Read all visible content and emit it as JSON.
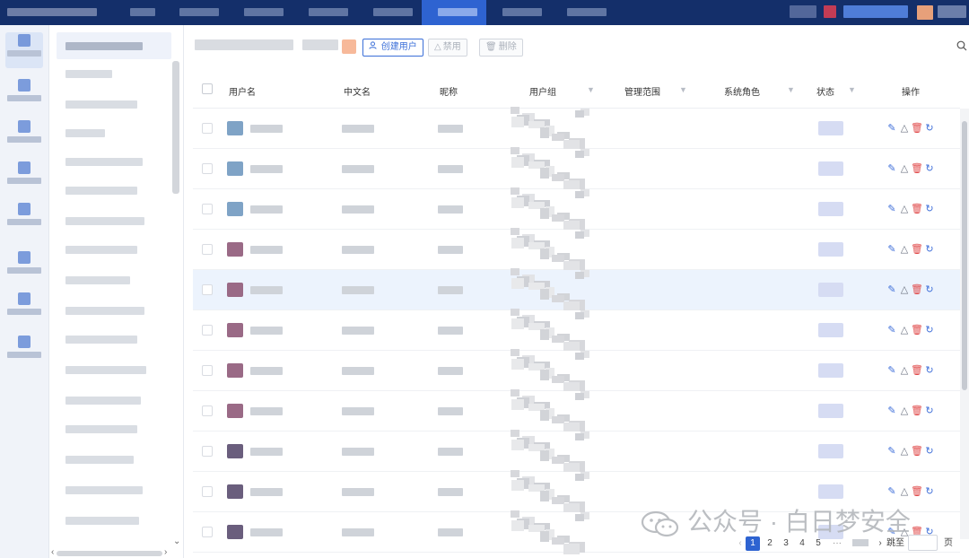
{
  "toolbar": {
    "create_user_label": "创建用户",
    "disable_label": "禁用",
    "delete_label": "删除"
  },
  "table": {
    "columns": {
      "username": "用户名",
      "chinese_name": "中文名",
      "nickname": "昵称",
      "user_group": "用户组",
      "scope": "管理范围",
      "system_role": "系统角色",
      "status": "状态",
      "actions": "操作"
    },
    "row_count": 11,
    "highlighted_row": 5
  },
  "pagination": {
    "pages": [
      "1",
      "2",
      "3",
      "4",
      "5"
    ],
    "current": "1",
    "ellipsis": "···",
    "jump_label": "跳至",
    "page_suffix": "页"
  },
  "watermark": {
    "text": "公众号 · 白日梦安全"
  },
  "colors": {
    "topbar": "#142f6a",
    "active_tab": "#2e63d1",
    "primary": "#3b6fd8",
    "danger": "#e04a4a",
    "row_highlight": "#ecf3fd"
  },
  "icons": {
    "create_user": "user-icon",
    "disable": "warning-icon",
    "delete": "trash-icon",
    "search": "search-icon",
    "filter": "funnel-icon",
    "row_actions": [
      "edit-icon",
      "warning-icon",
      "trash-icon",
      "refresh-icon"
    ]
  }
}
